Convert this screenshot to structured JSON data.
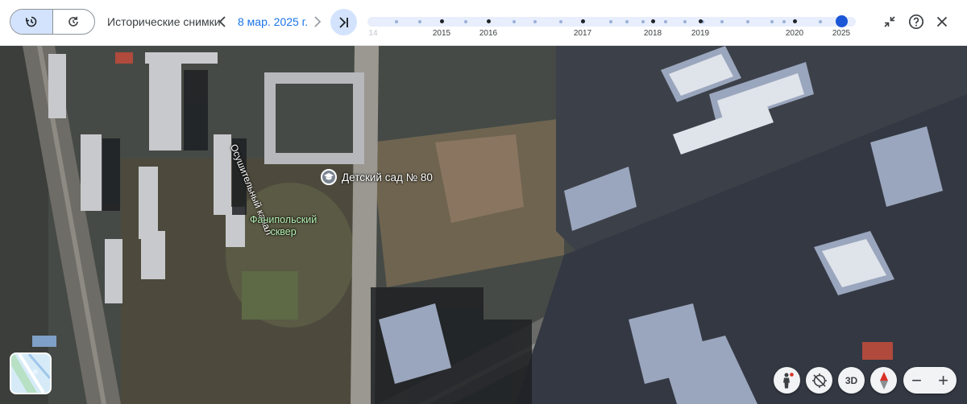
{
  "toolbar": {
    "historical_label": "Исторические снимки",
    "date_label": "8 мар. 2025 г.",
    "icons": {
      "history_toggle": "history-icon",
      "refresh_toggle": "refresh-icon",
      "prev": "chevron-left-icon",
      "next": "chevron-right-icon",
      "latest": "skip-to-latest-icon",
      "collapse": "collapse-icon",
      "help": "help-icon",
      "close": "close-icon"
    }
  },
  "timeline": {
    "year_labels": [
      {
        "label": "14",
        "cut": true
      },
      {
        "label": "2015"
      },
      {
        "label": "2016"
      },
      {
        "label": "2017"
      },
      {
        "label": "2018"
      },
      {
        "label": "2019"
      },
      {
        "label": "2020"
      },
      {
        "label": "2025"
      }
    ],
    "selected": "2025",
    "accent_color": "#1a56d6",
    "track_color": "#e8eefb"
  },
  "map": {
    "poi_label": "Детский сад № 80",
    "poi_icon": "school-icon",
    "park_label_line1": "Фанипольский",
    "park_label_line2": "сквер",
    "canal_label": "Осушительный канал",
    "park_label_color": "#b8f5b4"
  },
  "controls": {
    "pegman_icon": "pegman-icon",
    "rotate_icon": "rotate-view-icon",
    "btn_3d_label": "3D",
    "compass_icon": "compass-icon",
    "zoom_out_label": "−",
    "zoom_in_label": "+",
    "layers_icon": "layers-thumbnail"
  }
}
